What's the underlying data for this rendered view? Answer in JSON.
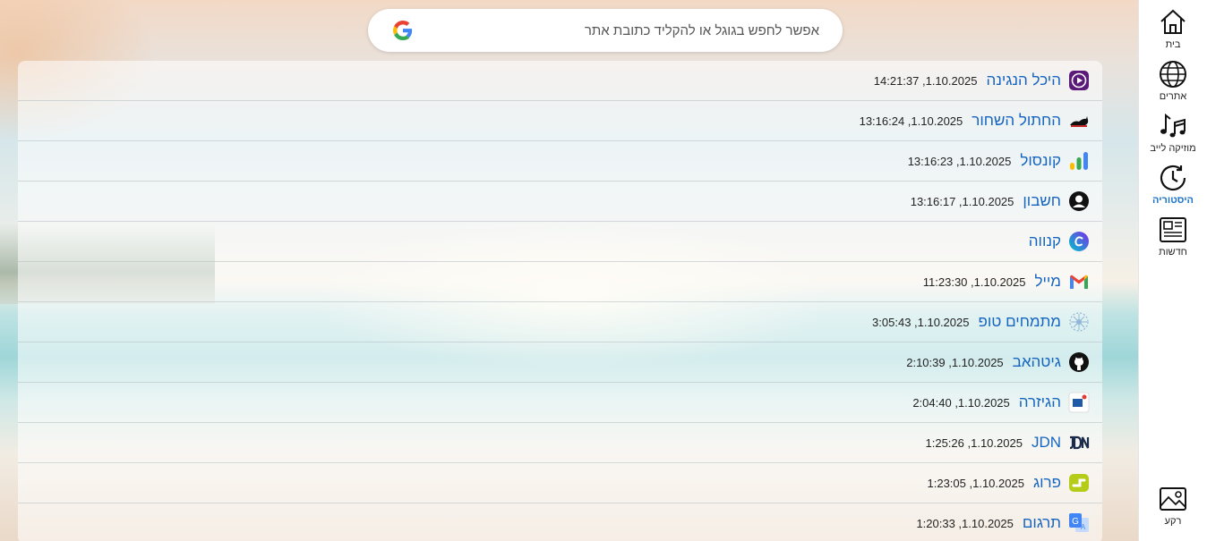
{
  "search": {
    "placeholder": "אפשר לחפש בגוגל או להקליד כתובת אתר"
  },
  "sidebar": {
    "items": [
      {
        "label": "בית",
        "icon": "home-icon"
      },
      {
        "label": "אתרים",
        "icon": "globe-icon"
      },
      {
        "label": "מוזיקה לייב",
        "icon": "music-icon"
      },
      {
        "label": "היסטוריה",
        "icon": "history-icon",
        "active": true
      },
      {
        "label": "חדשות",
        "icon": "news-icon"
      }
    ],
    "background_label": "רקע"
  },
  "history": [
    {
      "title": "היכל הנגינה",
      "time": "14:21:37 ,1.10.2025",
      "icon": "play-app-icon"
    },
    {
      "title": "החתול השחור",
      "time": "13:16:24 ,1.10.2025",
      "icon": "black-cat-icon"
    },
    {
      "title": "קונסול",
      "time": "13:16:23 ,1.10.2025",
      "icon": "analytics-console-icon"
    },
    {
      "title": "חשבון",
      "time": "13:16:17 ,1.10.2025",
      "icon": "account-icon"
    },
    {
      "title": "קנווה",
      "time": "",
      "icon": "canva-icon"
    },
    {
      "title": "מייל",
      "time": "11:23:30 ,1.10.2025",
      "icon": "gmail-icon"
    },
    {
      "title": "מתמחים טופ",
      "time": "3:05:43 ,1.10.2025",
      "icon": "network-icon"
    },
    {
      "title": "גיטהאב",
      "time": "2:10:39 ,1.10.2025",
      "icon": "github-icon"
    },
    {
      "title": "הגיזרה",
      "time": "2:04:40 ,1.10.2025",
      "icon": "hagizra-icon"
    },
    {
      "title": "JDN",
      "time": "1:25:26 ,1.10.2025",
      "icon": "jdn-icon"
    },
    {
      "title": "פרוג",
      "time": "1:23:05 ,1.10.2025",
      "icon": "prog-icon"
    },
    {
      "title": "תרגום",
      "time": "1:20:33 ,1.10.2025",
      "icon": "translate-icon"
    }
  ],
  "colors": {
    "link": "#1565c0",
    "active_sidebar": "#1a73c8"
  }
}
